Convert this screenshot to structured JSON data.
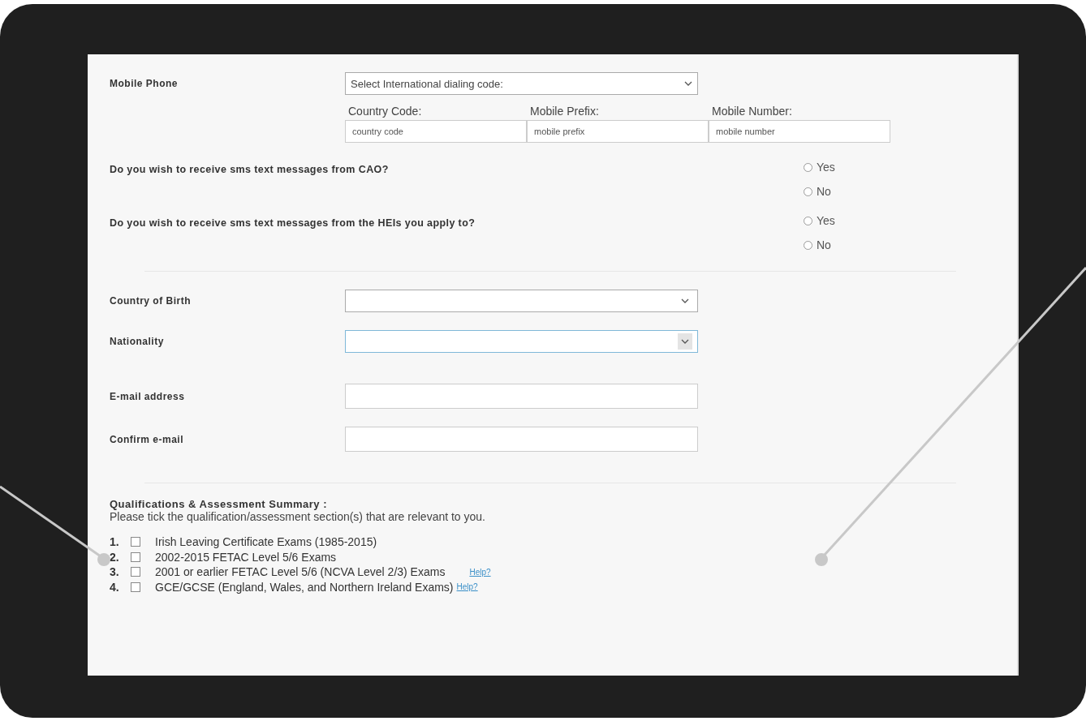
{
  "mobile_phone": {
    "label": "Mobile Phone",
    "select_value": "Select International dialing code:",
    "fields": [
      {
        "label": "Country Code:",
        "placeholder": "country code"
      },
      {
        "label": "Mobile Prefix:",
        "placeholder": "mobile prefix"
      },
      {
        "label": "Mobile Number:",
        "placeholder": "mobile number"
      }
    ]
  },
  "questions": [
    {
      "text": "Do you wish to receive sms text messages from CAO?",
      "options": [
        {
          "label": "Yes",
          "selected": false
        },
        {
          "label": "No",
          "selected": false
        }
      ]
    },
    {
      "text": "Do you wish to receive sms text messages from the HEIs you apply to?",
      "options": [
        {
          "label": "Yes",
          "selected": false
        },
        {
          "label": "No",
          "selected": false
        }
      ]
    }
  ],
  "personal": [
    {
      "kind": "select",
      "label": "Country of Birth",
      "focused": false
    },
    {
      "kind": "select",
      "label": "Nationality",
      "focused": true
    },
    {
      "kind": "text",
      "label": "E-mail address"
    },
    {
      "kind": "text",
      "label": "Confirm e-mail"
    }
  ],
  "qualifications": {
    "title": "Qualifications & Assessment Summary :",
    "instruction": "Please tick the qualification/assessment section(s) that are relevant to you.",
    "items": [
      {
        "number": "1.",
        "label": "Irish Leaving Certificate Exams (1985-2015)",
        "checked": false
      },
      {
        "number": "2.",
        "label": "2002-2015 FETAC Level 5/6 Exams",
        "checked": false
      },
      {
        "number": "3.",
        "label": "2001 or earlier FETAC Level 5/6 (NCVA Level 2/3) Exams",
        "checked": false,
        "help": "Help?"
      },
      {
        "number": "4.",
        "label": "GCE/GCSE (England, Wales, and Northern Ireland Exams)",
        "checked": false,
        "help": "Help?"
      }
    ]
  }
}
